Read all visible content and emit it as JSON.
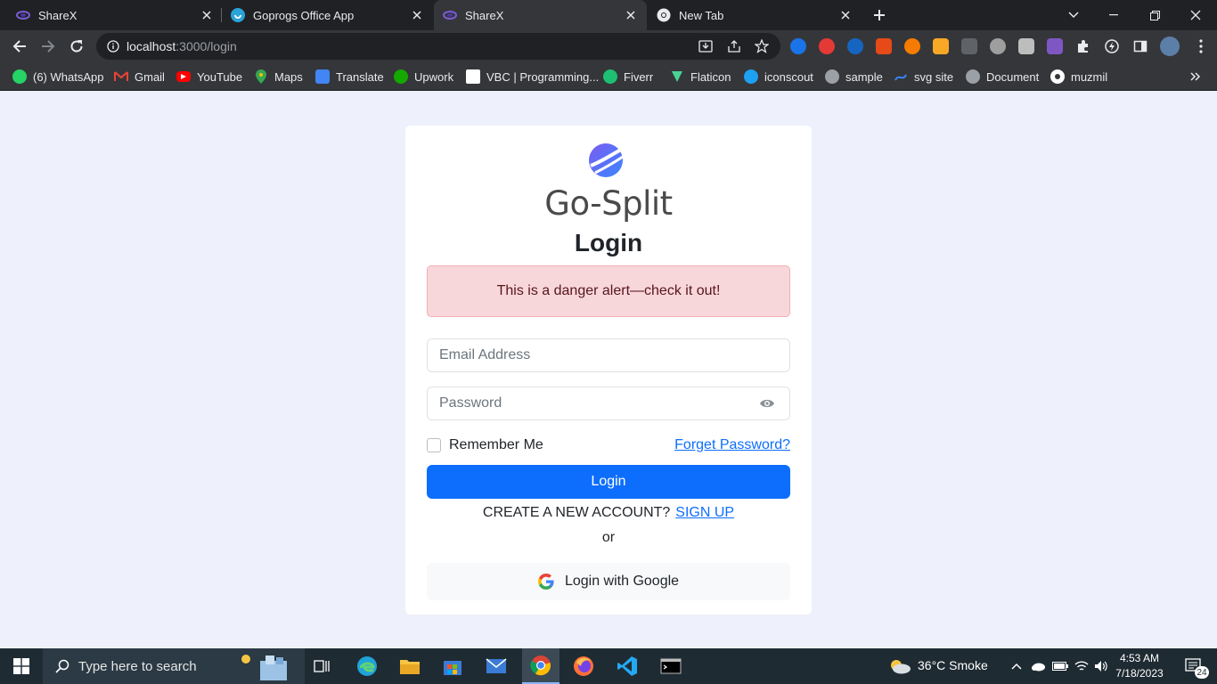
{
  "browser": {
    "tabs": [
      {
        "title": "ShareX",
        "icon": "sharex-icon"
      },
      {
        "title": "Goprogs Office App",
        "icon": "goprogs-icon"
      },
      {
        "title": "ShareX",
        "icon": "sharex-icon"
      },
      {
        "title": "New Tab",
        "icon": "chrome-icon"
      }
    ],
    "url_host": "localhost",
    "url_path": ":3000/login",
    "bookmarks": [
      {
        "label": "(6) WhatsApp",
        "icon": "whatsapp-icon",
        "color": "#25d366"
      },
      {
        "label": "Gmail",
        "icon": "gmail-icon",
        "color": "#ea4335"
      },
      {
        "label": "YouTube",
        "icon": "youtube-icon",
        "color": "#ff0000"
      },
      {
        "label": "Maps",
        "icon": "maps-icon",
        "color": "#34a853"
      },
      {
        "label": "Translate",
        "icon": "translate-icon",
        "color": "#4285f4"
      },
      {
        "label": "Upwork",
        "icon": "upwork-icon",
        "color": "#14a800"
      },
      {
        "label": "VBC | Programming...",
        "icon": "vbc-icon",
        "color": "#ffffff"
      },
      {
        "label": "Fiverr",
        "icon": "fiverr-icon",
        "color": "#1dbf73"
      },
      {
        "label": "Flaticon",
        "icon": "flaticon-icon",
        "color": "#4ad295"
      },
      {
        "label": "iconscout",
        "icon": "iconscout-icon",
        "color": "#1da1f2"
      },
      {
        "label": "sample",
        "icon": "globe-icon",
        "color": "#9aa0a6"
      },
      {
        "label": "svg site",
        "icon": "svg-icon",
        "color": "#3b82f6"
      },
      {
        "label": "Document",
        "icon": "globe-icon",
        "color": "#9aa0a6"
      },
      {
        "label": "muzmil",
        "icon": "github-icon",
        "color": "#ffffff"
      }
    ]
  },
  "page": {
    "brand": "Go-Split",
    "title": "Login",
    "alert": "This is a danger alert—check it out!",
    "email_placeholder": "Email Address",
    "password_placeholder": "Password",
    "remember_label": "Remember Me",
    "forgot_label": "Forget Password?",
    "login_button": "Login",
    "create_account_text": "CREATE A NEW ACCOUNT?",
    "signup_label": "SIGN UP",
    "or_text": "or",
    "google_button": "Login with Google",
    "colors": {
      "primary": "#0d6efd",
      "alert_bg": "#f8d7da",
      "alert_text": "#58151c",
      "page_bg": "#eef1fb"
    }
  },
  "taskbar": {
    "search_placeholder": "Type here to search",
    "weather": "36°C  Smoke",
    "time": "4:53 AM",
    "date": "7/18/2023",
    "notification_count": "24"
  }
}
